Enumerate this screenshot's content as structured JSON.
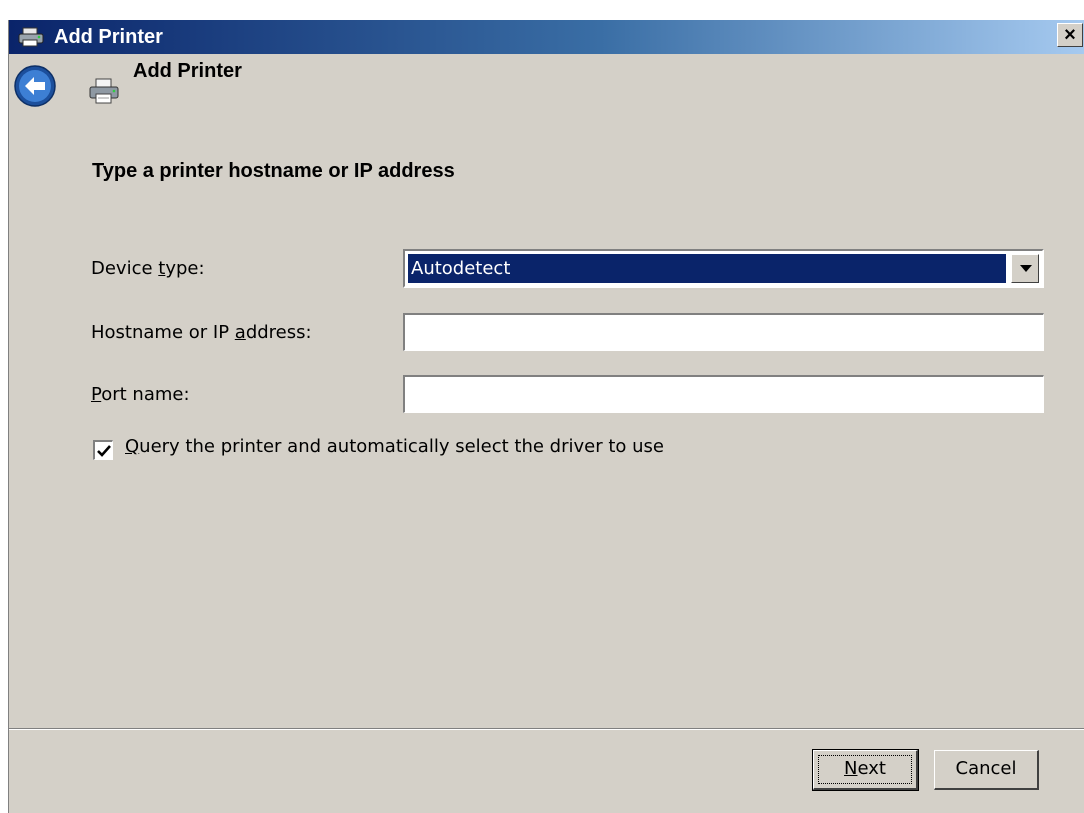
{
  "window": {
    "title": "Add Printer",
    "close_glyph": "×"
  },
  "nav": {
    "title": "Add Printer",
    "back_icon": "back-arrow-icon",
    "printer_icon": "printer-icon"
  },
  "page": {
    "heading": "Type a printer hostname or IP address"
  },
  "form": {
    "device_type": {
      "label_pre": "Device ",
      "label_u": "t",
      "label_post": "ype:",
      "value": "Autodetect"
    },
    "hostname": {
      "label_pre": "Hostname or IP ",
      "label_u": "a",
      "label_post": "ddress:",
      "value": ""
    },
    "port": {
      "label_pre": "",
      "label_u": "P",
      "label_post": "ort name:",
      "value": ""
    },
    "query_checkbox": {
      "checked": true,
      "label_pre": "",
      "label_u": "Q",
      "label_post": "uery the printer and automatically select the driver to use"
    }
  },
  "buttons": {
    "next": {
      "pre": "",
      "u": "N",
      "post": "ext"
    },
    "cancel": {
      "label": "Cancel"
    }
  },
  "colors": {
    "titlebar_start": "#0a246a",
    "titlebar_end": "#a6caf0",
    "dialog_bg": "#d4d0c8",
    "selection": "#0a246a"
  }
}
